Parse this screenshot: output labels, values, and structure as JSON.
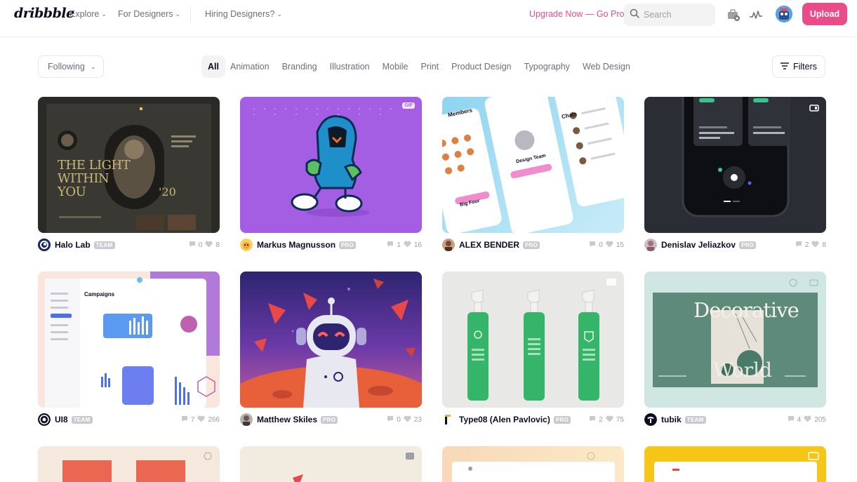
{
  "header": {
    "logo": "dribbble",
    "nav": [
      {
        "label": "Explore"
      },
      {
        "label": "For Designers"
      },
      {
        "label": "Hiring Designers?"
      }
    ],
    "upgrade": "Upgrade Now — Go Pro",
    "search_placeholder": "Search",
    "upload": "Upload"
  },
  "filters": {
    "following": "Following",
    "categories": [
      "All",
      "Animation",
      "Branding",
      "Illustration",
      "Mobile",
      "Print",
      "Product Design",
      "Typography",
      "Web Design"
    ],
    "active_category": "All",
    "filters_label": "Filters"
  },
  "shots": [
    {
      "author": "Halo Lab",
      "badge": "TEAM",
      "comments": "0",
      "likes": "8",
      "thumb_text": [
        "THE LIGHT",
        "WITHIN",
        "YOU",
        "'20"
      ]
    },
    {
      "author": "Markus Magnusson",
      "badge": "PRO",
      "comments": "1",
      "likes": "16",
      "corner": "GIF"
    },
    {
      "author": "ALEX BENDER",
      "badge": "PRO",
      "comments": "0",
      "likes": "15",
      "thumb_text": [
        "Members",
        "Chats",
        "Design Team",
        "Big Four"
      ]
    },
    {
      "author": "Denislav Jeliazkov",
      "badge": "PRO",
      "comments": "2",
      "likes": "8"
    },
    {
      "author": "UI8",
      "badge": "TEAM",
      "comments": "7",
      "likes": "266",
      "thumb_text": [
        "Campaigns"
      ]
    },
    {
      "author": "Matthew Skiles",
      "badge": "PRO",
      "comments": "0",
      "likes": "23"
    },
    {
      "author": "Type08 (Alen Pavlovic)",
      "badge": "PRO",
      "comments": "2",
      "likes": "75"
    },
    {
      "author": "tubik",
      "badge": "TEAM",
      "comments": "4",
      "likes": "205",
      "thumb_text": [
        "Decorative",
        "World"
      ]
    }
  ],
  "colors": {
    "brand": "#ea4c89",
    "text": "#0d0c22",
    "muted": "#6e6d7a"
  }
}
